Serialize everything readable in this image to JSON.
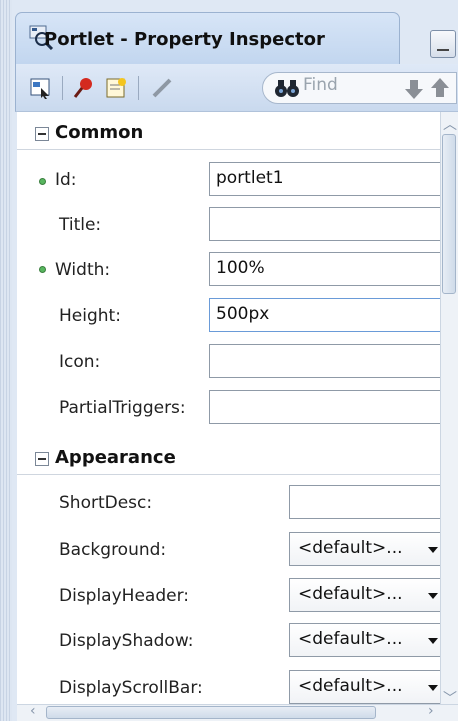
{
  "window": {
    "title": "Portlet - Property Inspector"
  },
  "toolbar": {
    "find_placeholder": "Find",
    "icons": [
      "select-icon",
      "pin-icon",
      "edit-properties-icon",
      "pencil-icon",
      "binoculars-icon",
      "arrow-down-icon",
      "arrow-up-icon"
    ]
  },
  "sections": {
    "common": {
      "label": "Common",
      "props": {
        "id": {
          "label": "Id:",
          "value": "portlet1",
          "required": true
        },
        "title": {
          "label": "Title:",
          "value": ""
        },
        "width": {
          "label": "Width:",
          "value": "100%",
          "required": true
        },
        "height": {
          "label": "Height:",
          "value": "500px"
        },
        "icon": {
          "label": "Icon:",
          "value": ""
        },
        "partial_triggers": {
          "label": "PartialTriggers:",
          "value": ""
        }
      }
    },
    "appearance": {
      "label": "Appearance",
      "props": {
        "short_desc": {
          "label": "ShortDesc:",
          "value": ""
        },
        "background": {
          "label": "Background:",
          "value": "<default>..."
        },
        "display_header": {
          "label": "DisplayHeader:",
          "value": "<default>..."
        },
        "display_shadow": {
          "label": "DisplayShadow:",
          "value": "<default>..."
        },
        "display_scrollbar": {
          "label": "DisplayScrollBar:",
          "value": "<default>..."
        }
      }
    }
  },
  "colors": {
    "required_dot": "#58b65f",
    "tab_background": "#c2d6ef"
  }
}
